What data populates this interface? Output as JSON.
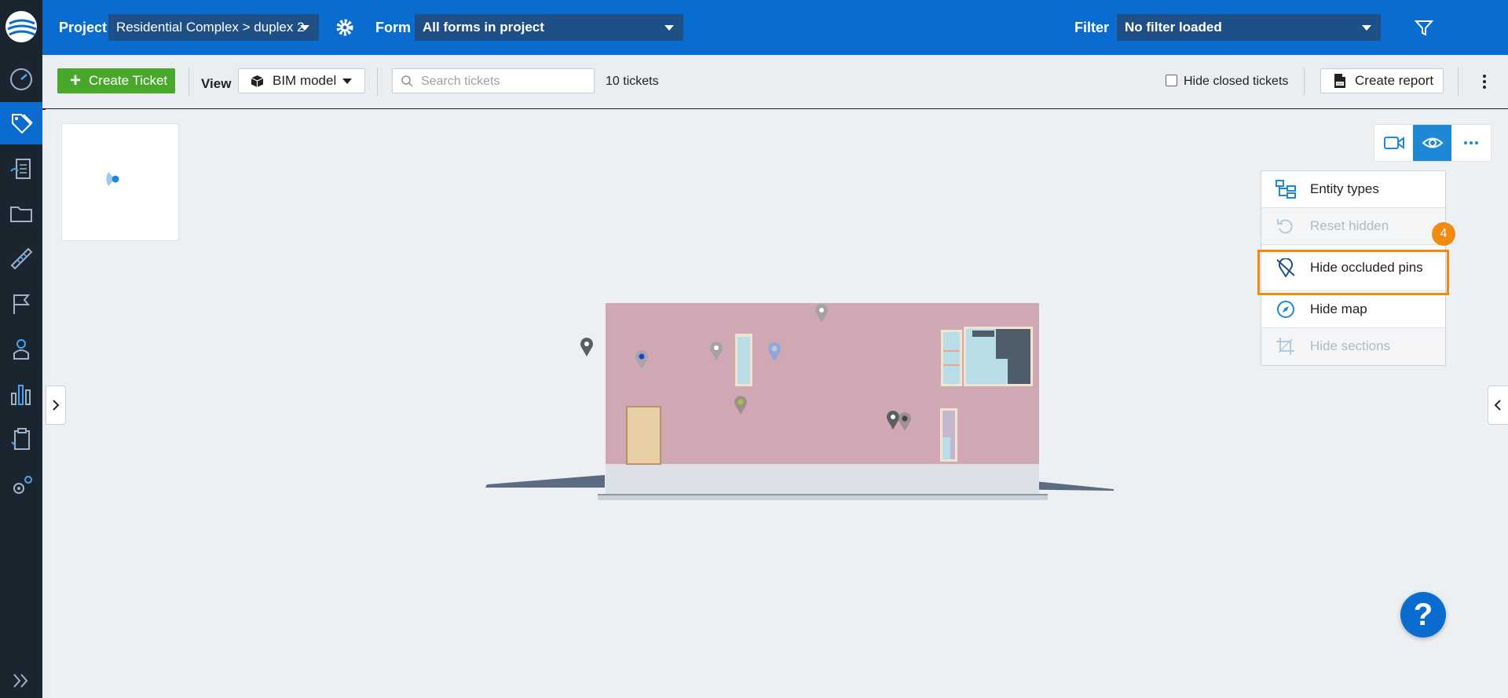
{
  "topbar": {
    "project_label": "Project",
    "project_value": "Residential Complex > duplex 2",
    "form_label": "Form",
    "form_value": "All forms in project",
    "filter_label": "Filter",
    "filter_value": "No filter loaded"
  },
  "toolbar": {
    "create_label": "Create Ticket",
    "view_label": "View",
    "view_value": "BIM model",
    "search_placeholder": "Search tickets",
    "ticket_count": "10 tickets",
    "hide_closed_label": "Hide closed tickets",
    "report_label": "Create report"
  },
  "viewer_menu": {
    "items": [
      {
        "label": "Entity types",
        "icon": "entity-types-icon",
        "enabled": true
      },
      {
        "label": "Reset hidden",
        "icon": "reset-icon",
        "enabled": false
      },
      {
        "label": "Hide occluded pins",
        "icon": "hide-pin-icon",
        "enabled": true
      },
      {
        "label": "Hide map",
        "icon": "compass-icon",
        "enabled": true
      },
      {
        "label": "Hide sections",
        "icon": "crop-icon",
        "enabled": false
      }
    ]
  },
  "annotation": {
    "step_number": "4"
  },
  "help": {
    "label": "?"
  },
  "colors": {
    "brand_blue": "#0b6cd0",
    "create_green": "#48a82c",
    "highlight_orange": "#f08a12",
    "rail_dark": "#1b2530",
    "wall_pink": "#d0a8b4"
  }
}
